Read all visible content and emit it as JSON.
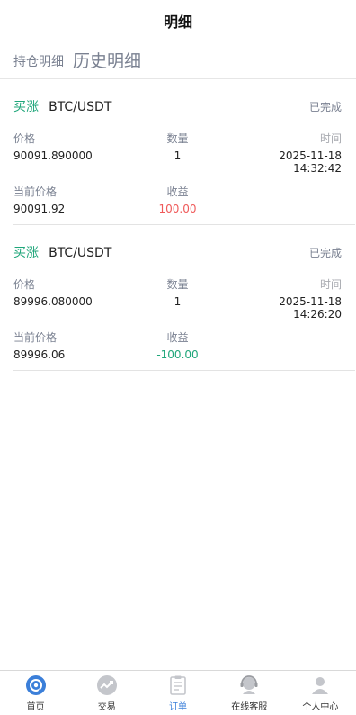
{
  "header": {
    "title": "明细"
  },
  "tabs": {
    "holding": "持仓明细",
    "history": "历史明细"
  },
  "orders": [
    {
      "direction": "买涨",
      "pair": "BTC/USDT",
      "status": "已完成",
      "price_label": "价格",
      "qty_label": "数量",
      "time_label": "时间",
      "price": "90091.890000",
      "qty": "1",
      "time": "2025-11-18 14:32:42",
      "current_label": "当前价格",
      "profit_label": "收益",
      "current": "90091.92",
      "profit": "100.00"
    },
    {
      "direction": "买涨",
      "pair": "BTC/USDT",
      "status": "已完成",
      "price_label": "价格",
      "qty_label": "数量",
      "time_label": "时间",
      "price": "89996.080000",
      "qty": "1",
      "time": "2025-11-18 14:26:20",
      "current_label": "当前价格",
      "profit_label": "收益",
      "current": "89996.06",
      "profit": "-100.00"
    }
  ],
  "tabbar": [
    {
      "label": "首页",
      "icon": "home-icon",
      "color": "#3b7fd9"
    },
    {
      "label": "交易",
      "icon": "trade-icon",
      "color": "#c4c6cb"
    },
    {
      "label": "订单",
      "icon": "order-icon",
      "color": "#c4c6cb"
    },
    {
      "label": "在线客服",
      "icon": "customer-service-icon",
      "color": "#c4c6cb"
    },
    {
      "label": "个人中心",
      "icon": "profile-icon",
      "color": "#c4c6cb"
    }
  ],
  "colors": {
    "up": "#1fa67a",
    "profit_positive": "#ef5a5a",
    "profit_negative": "#1fa67a",
    "active_tab": "#3b7fd9"
  }
}
